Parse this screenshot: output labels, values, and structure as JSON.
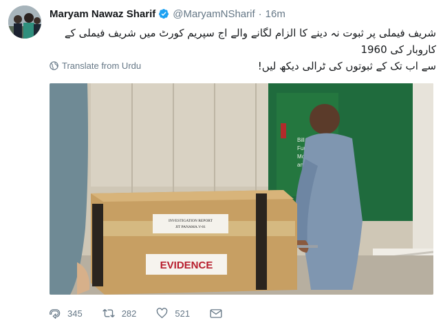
{
  "tweet": {
    "author_name": "Maryam Nawaz Sharif",
    "handle": "@MaryamNSharif",
    "separator": "·",
    "time": "16m",
    "text_line1": "شریف فیملی پر ثبوت نہ دینے کا الزام لگانے والے اج سپریم کورٹ میں شریف فیملی کے کاروبار کی 1960",
    "text_line2": "سے اب تک کے ثبوتوں کی ٹرالی دیکھ لیں!",
    "translate_label": "Translate from Urdu"
  },
  "media": {
    "box_label": "EVIDENCE",
    "box_paper_line1": "INVESTIGATION REPORT",
    "box_paper_line2": "JIT PANAMA.V-01",
    "sign_line1": "Bill Payme",
    "sign_line2": "Funds Tran",
    "sign_line3": "Mobile Sol",
    "sign_line4": "and m"
  },
  "actions": {
    "replies": "345",
    "retweets": "282",
    "likes": "521"
  },
  "colors": {
    "verified_blue": "#1da1f2",
    "secondary_text": "#657786",
    "door_green": "#1f6b3d"
  },
  "icons": [
    "verified-badge-icon",
    "globe-icon",
    "reply-icon",
    "retweet-icon",
    "like-icon",
    "direct-message-icon"
  ]
}
